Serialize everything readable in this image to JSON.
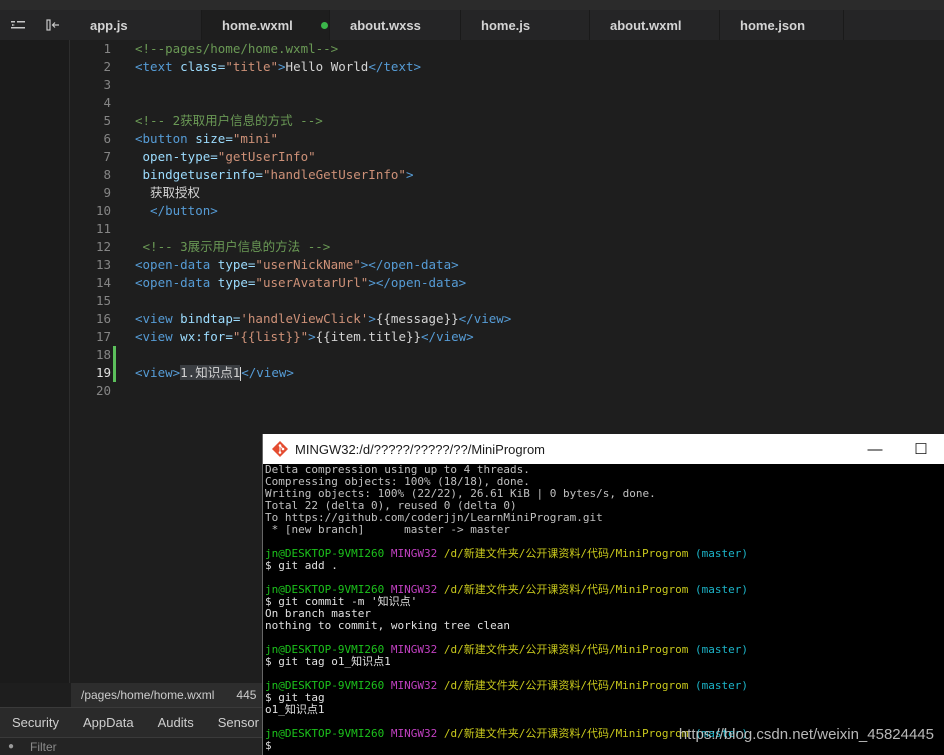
{
  "tabs": [
    {
      "label": "app.js"
    },
    {
      "label": "home.wxml"
    },
    {
      "label": "about.wxss"
    },
    {
      "label": "home.js"
    },
    {
      "label": "about.wxml"
    },
    {
      "label": "home.json"
    }
  ],
  "tool_icons": {
    "first": "list-indent-icon",
    "second": "split-collapse-icon"
  },
  "editor": {
    "line_numbers": [
      "1",
      "2",
      "3",
      "4",
      "5",
      "6",
      "7",
      "8",
      "9",
      "10",
      "11",
      "12",
      "13",
      "14",
      "15",
      "16",
      "17",
      "18",
      "19",
      "20"
    ],
    "lines": {
      "l1": "<!--pages/home/home.wxml-->",
      "l2_open": "<text",
      "l2_attr": " class=",
      "l2_val": "\"title\"",
      "l2_gt": ">",
      "l2_text": "Hello World",
      "l2_close": "</text>",
      "l5": "<!-- 2获取用户信息的方式 -->",
      "l6_open": "<button",
      "l6_attr": " size=",
      "l6_val": "\"mini\"",
      "l7_attr": " open-type=",
      "l7_val": "\"getUserInfo\"",
      "l8_attr": " bindgetuserinfo=",
      "l8_val": "\"handleGetUserInfo\"",
      "l8_gt": ">",
      "l9_text": "  获取授权",
      "l10_close": "  </button>",
      "l12": " <!-- 3展示用户信息的方法 -->",
      "l13_open": "<open-data",
      "l13_attr": " type=",
      "l13_val": "\"userNickName\"",
      "l13_close": "></open-data>",
      "l14_open": "<open-data",
      "l14_attr": " type=",
      "l14_val": "\"userAvatarUrl\"",
      "l14_close": "></open-data>",
      "l16_open": "<view",
      "l16_attr": " bindtap=",
      "l16_val": "'handleViewClick'",
      "l16_gt": ">",
      "l16_text": "{{message}}",
      "l16_close": "</view>",
      "l17_open": "<view",
      "l17_attr": " wx:for=",
      "l17_val": "\"{{list}}\"",
      "l17_gt": ">",
      "l17_text": "{{item.title}}",
      "l17_close": "</view>",
      "l19_open": "<view>",
      "l19_text": "1.知识点1",
      "l19_close": "</view>"
    }
  },
  "status": {
    "path": "/pages/home/home.wxml",
    "size": "445"
  },
  "devtools": {
    "tabs": [
      "Security",
      "AppData",
      "Audits",
      "Sensor"
    ],
    "filter_placeholder": "Filter"
  },
  "terminal": {
    "title": "MINGW32:/d/?????/?????/??/MiniProgrom",
    "controls": {
      "minimize": "—",
      "maximize": "☐"
    },
    "lines": [
      "Delta compression using up to 4 threads.",
      "Compressing objects: 100% (18/18), done.",
      "Writing objects: 100% (22/22), 26.61 KiB | 0 bytes/s, done.",
      "Total 22 (delta 0), reused 0 (delta 0)",
      "To https://github.com/coderjjn/LearnMiniProgram.git",
      " * [new branch]      master -> master"
    ],
    "prompt_user": "jn@DESKTOP-9VMI260",
    "prompt_env": "MINGW32",
    "prompt_path": "/d/新建文件夹/公开课资料/代码/MiniProgrom",
    "prompt_branch": "(master)",
    "cmd1": "$ git add .",
    "cmd2": "$ git commit -m '知识点'",
    "out2a": "On branch master",
    "out2b": "nothing to commit, working tree clean",
    "cmd3": "$ git tag o1_知识点1",
    "cmd4": "$ git tag",
    "out4": "o1_知识点1",
    "cmd5": "$"
  },
  "watermark": "https://blog.csdn.net/weixin_45824445"
}
